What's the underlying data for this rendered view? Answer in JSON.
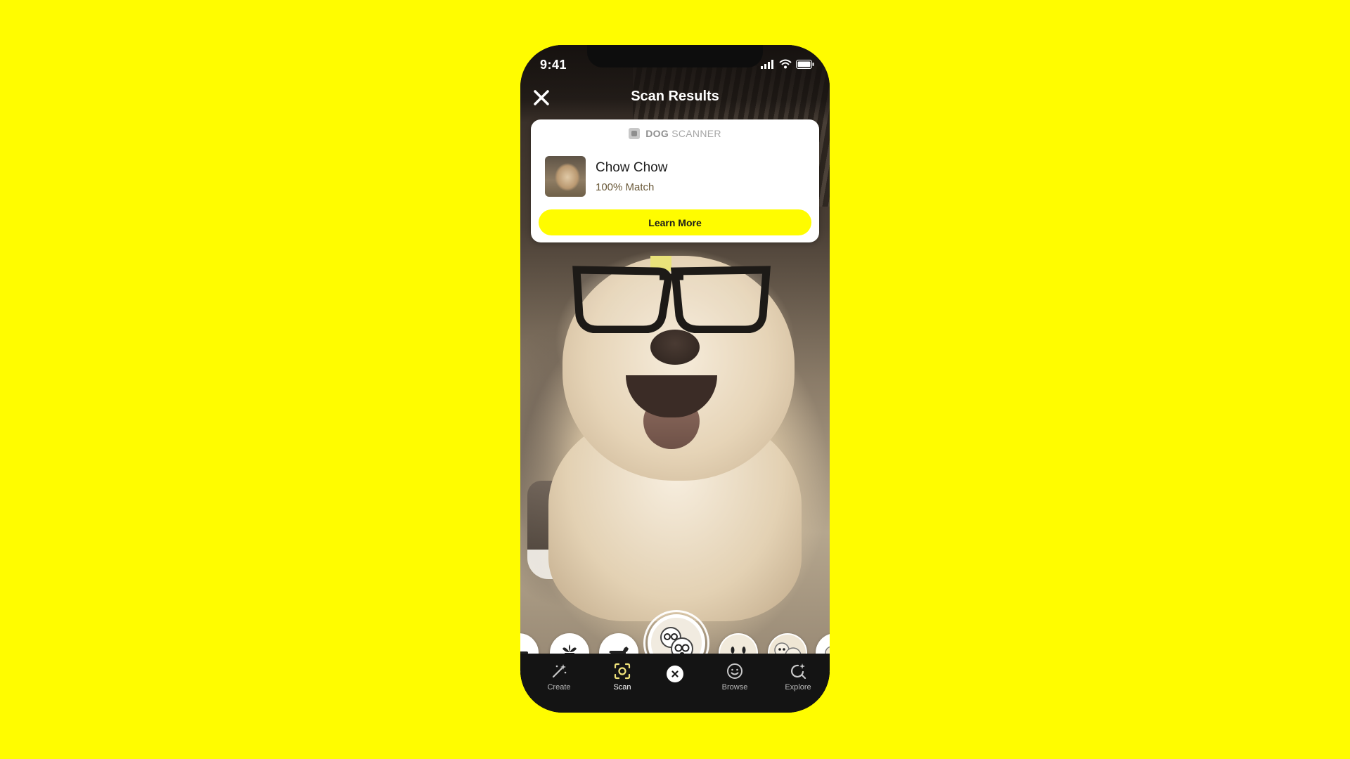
{
  "status_bar": {
    "time": "9:41"
  },
  "header": {
    "title": "Scan Results",
    "close_icon": "close-icon"
  },
  "scan_card": {
    "brand": "DOG",
    "scanner_label": "SCANNER",
    "result_name": "Chow Chow",
    "result_match": "100% Match",
    "learn_more_label": "Learn More"
  },
  "lens_carousel": {
    "lenses": [
      {
        "icon": "partial-lens-icon"
      },
      {
        "icon": "plant-icon"
      },
      {
        "icon": "dog-icon"
      },
      {
        "icon": "dog-glasses-lens-icon",
        "selected": true
      },
      {
        "icon": "smile-face-lens-icon"
      },
      {
        "icon": "cartoon-faces-lens-icon"
      },
      {
        "icon": "partial-lens-icon"
      }
    ]
  },
  "bottom_nav": {
    "items": [
      {
        "label": "Create",
        "icon": "magic-wand-icon"
      },
      {
        "label": "Scan",
        "icon": "scan-icon",
        "active": true
      },
      {
        "label": "",
        "icon": "close-circle-icon"
      },
      {
        "label": "Browse",
        "icon": "smiley-icon"
      },
      {
        "label": "Explore",
        "icon": "explore-icon"
      }
    ]
  },
  "colors": {
    "background": "#FFFC00",
    "accent": "#FFFC00",
    "nav_background": "#141414",
    "card": "#ffffff"
  }
}
